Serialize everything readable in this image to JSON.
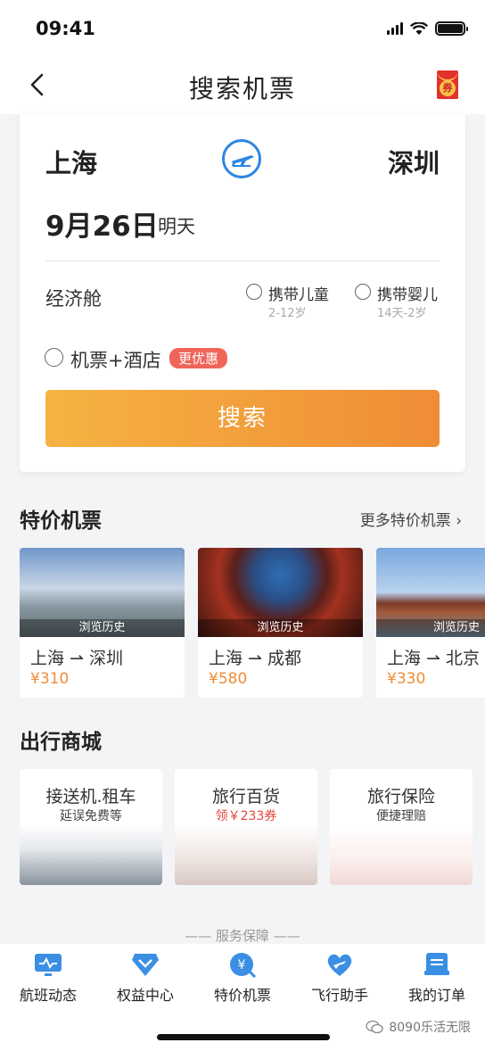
{
  "status": {
    "time": "09:41"
  },
  "header": {
    "title": "搜索机票",
    "coupon_char": "券"
  },
  "search": {
    "from_city": "上海",
    "to_city": "深圳",
    "date": "9月26日",
    "date_sub": "明天",
    "cabin": "经济舱",
    "options": [
      {
        "label": "携带儿童",
        "sub": "2-12岁"
      },
      {
        "label": "携带婴儿",
        "sub": "14天-2岁"
      }
    ],
    "combo_label": "机票+酒店",
    "combo_badge": "更优惠",
    "button": "搜索",
    "accent": "#2d86e0",
    "button_colors": [
      "#f5b342",
      "#f08c36"
    ]
  },
  "deals": {
    "title": "特价机票",
    "more": "更多特价机票 ›",
    "items": [
      {
        "history": "浏览历史",
        "route": "上海 ⇀ 深圳",
        "price": "¥310"
      },
      {
        "history": "浏览历史",
        "route": "上海 ⇀ 成都",
        "price": "¥580"
      },
      {
        "history": "浏览历史",
        "route": "上海 ⇀ 北京",
        "price": "¥330"
      }
    ]
  },
  "mall": {
    "title": "出行商城",
    "items": [
      {
        "title": "接送机.租车",
        "sub": "延误免费等"
      },
      {
        "title": "旅行百货",
        "sub": "领￥233券"
      },
      {
        "title": "旅行保险",
        "sub": "便捷理赔"
      }
    ]
  },
  "service_label": "—— 服务保障 ——",
  "tabs": [
    {
      "label": "航班动态",
      "icon": "flight-status-icon"
    },
    {
      "label": "权益中心",
      "icon": "benefits-icon"
    },
    {
      "label": "特价机票",
      "icon": "discount-ticket-icon"
    },
    {
      "label": "飞行助手",
      "icon": "flight-assistant-icon"
    },
    {
      "label": "我的订单",
      "icon": "orders-icon"
    }
  ],
  "watermark": "8090乐活无限"
}
